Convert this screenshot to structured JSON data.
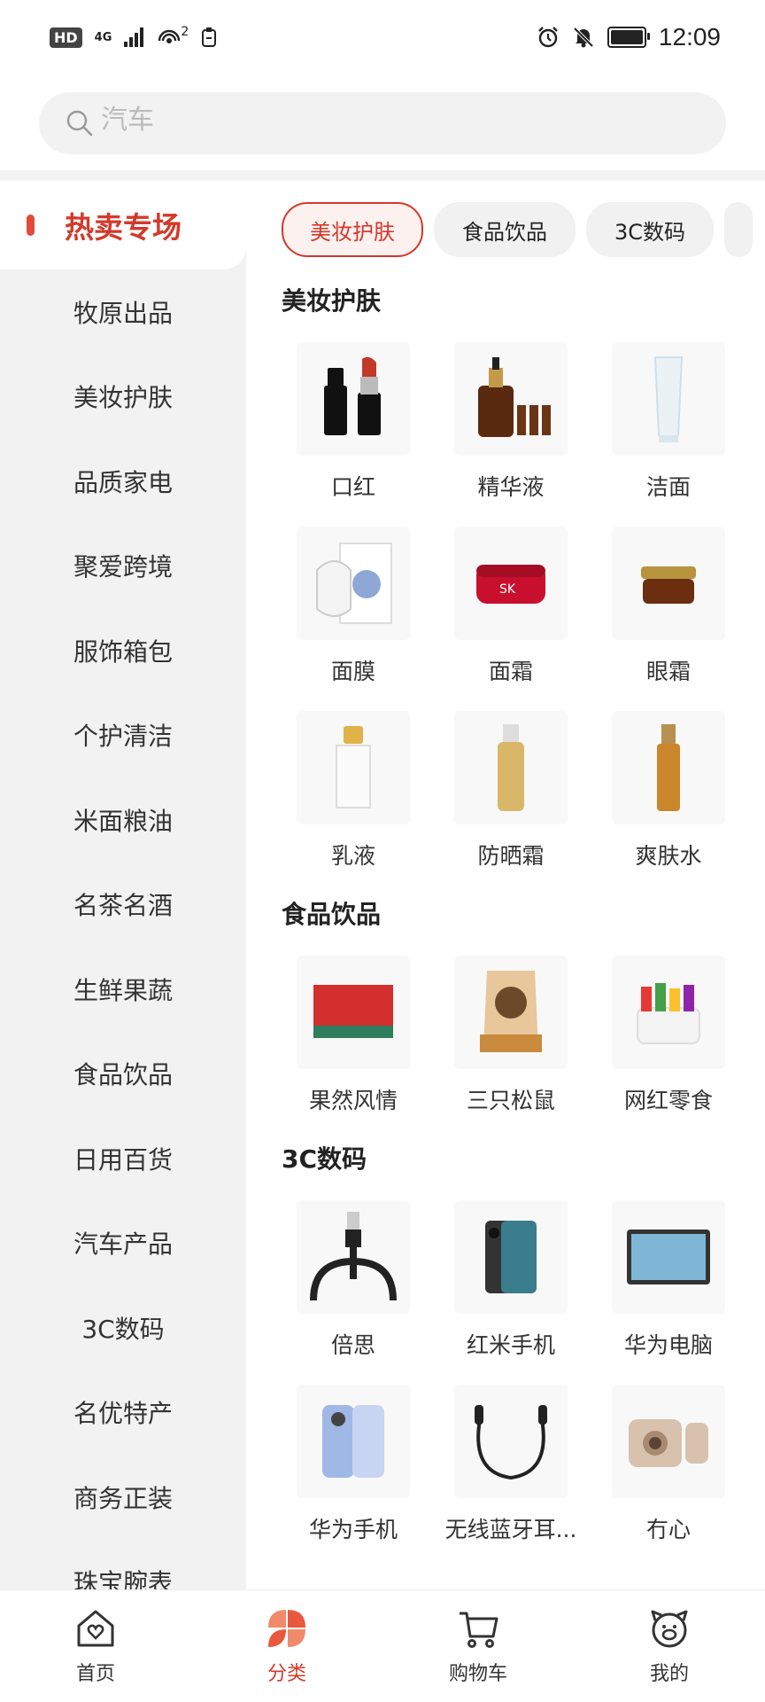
{
  "status_bar": {
    "left_badges": [
      "HD",
      "4G",
      "2"
    ],
    "time": "12:09",
    "battery_level": 1.0
  },
  "search": {
    "placeholder": "汽车"
  },
  "sidebar": {
    "items": [
      {
        "label": "热卖专场"
      },
      {
        "label": "牧原出品"
      },
      {
        "label": "美妆护肤"
      },
      {
        "label": "品质家电"
      },
      {
        "label": "聚爱跨境"
      },
      {
        "label": "服饰箱包"
      },
      {
        "label": "个护清洁"
      },
      {
        "label": "米面粮油"
      },
      {
        "label": "名茶名酒"
      },
      {
        "label": "生鲜果蔬"
      },
      {
        "label": "食品饮品"
      },
      {
        "label": "日用百货"
      },
      {
        "label": "汽车产品"
      },
      {
        "label": "3C数码"
      },
      {
        "label": "名优特产"
      },
      {
        "label": "商务正装"
      },
      {
        "label": "珠宝腕表"
      }
    ]
  },
  "chips": [
    {
      "label": "美妆护肤"
    },
    {
      "label": "食品饮品"
    },
    {
      "label": "3C数码"
    }
  ],
  "sections": [
    {
      "title": "美妆护肤",
      "items": [
        {
          "label": "口红",
          "icon": "lipstick-icon"
        },
        {
          "label": "精华液",
          "icon": "serum-icon"
        },
        {
          "label": "洁面",
          "icon": "cleanser-icon"
        },
        {
          "label": "面膜",
          "icon": "face-mask-icon"
        },
        {
          "label": "面霜",
          "icon": "face-cream-icon"
        },
        {
          "label": "眼霜",
          "icon": "eye-cream-icon"
        },
        {
          "label": "乳液",
          "icon": "lotion-icon"
        },
        {
          "label": "防晒霜",
          "icon": "sunscreen-icon"
        },
        {
          "label": "爽肤水",
          "icon": "toner-icon"
        }
      ]
    },
    {
      "title": "食品饮品",
      "items": [
        {
          "label": "果然风情",
          "icon": "gift-box-icon"
        },
        {
          "label": "三只松鼠",
          "icon": "snack-bag-icon"
        },
        {
          "label": "网红零食",
          "icon": "snack-basket-icon"
        }
      ]
    },
    {
      "title": "3C数码",
      "items": [
        {
          "label": "倍思",
          "icon": "usb-cable-icon"
        },
        {
          "label": "红米手机",
          "icon": "phone-icon"
        },
        {
          "label": "华为电脑",
          "icon": "tablet-icon"
        },
        {
          "label": "华为手机",
          "icon": "phone-blue-icon"
        },
        {
          "label": "无线蓝牙耳...",
          "icon": "earphones-icon"
        },
        {
          "label": "冇心",
          "icon": "camera-icon"
        }
      ]
    }
  ],
  "tabbar": {
    "items": [
      {
        "label": "首页",
        "icon": "home-heart-icon"
      },
      {
        "label": "分类",
        "icon": "category-petals-icon"
      },
      {
        "label": "购物车",
        "icon": "cart-icon"
      },
      {
        "label": "我的",
        "icon": "profile-pig-icon"
      }
    ]
  },
  "colors": {
    "accent": "#d3392b",
    "sidebar_bg": "#f2f2f2"
  }
}
